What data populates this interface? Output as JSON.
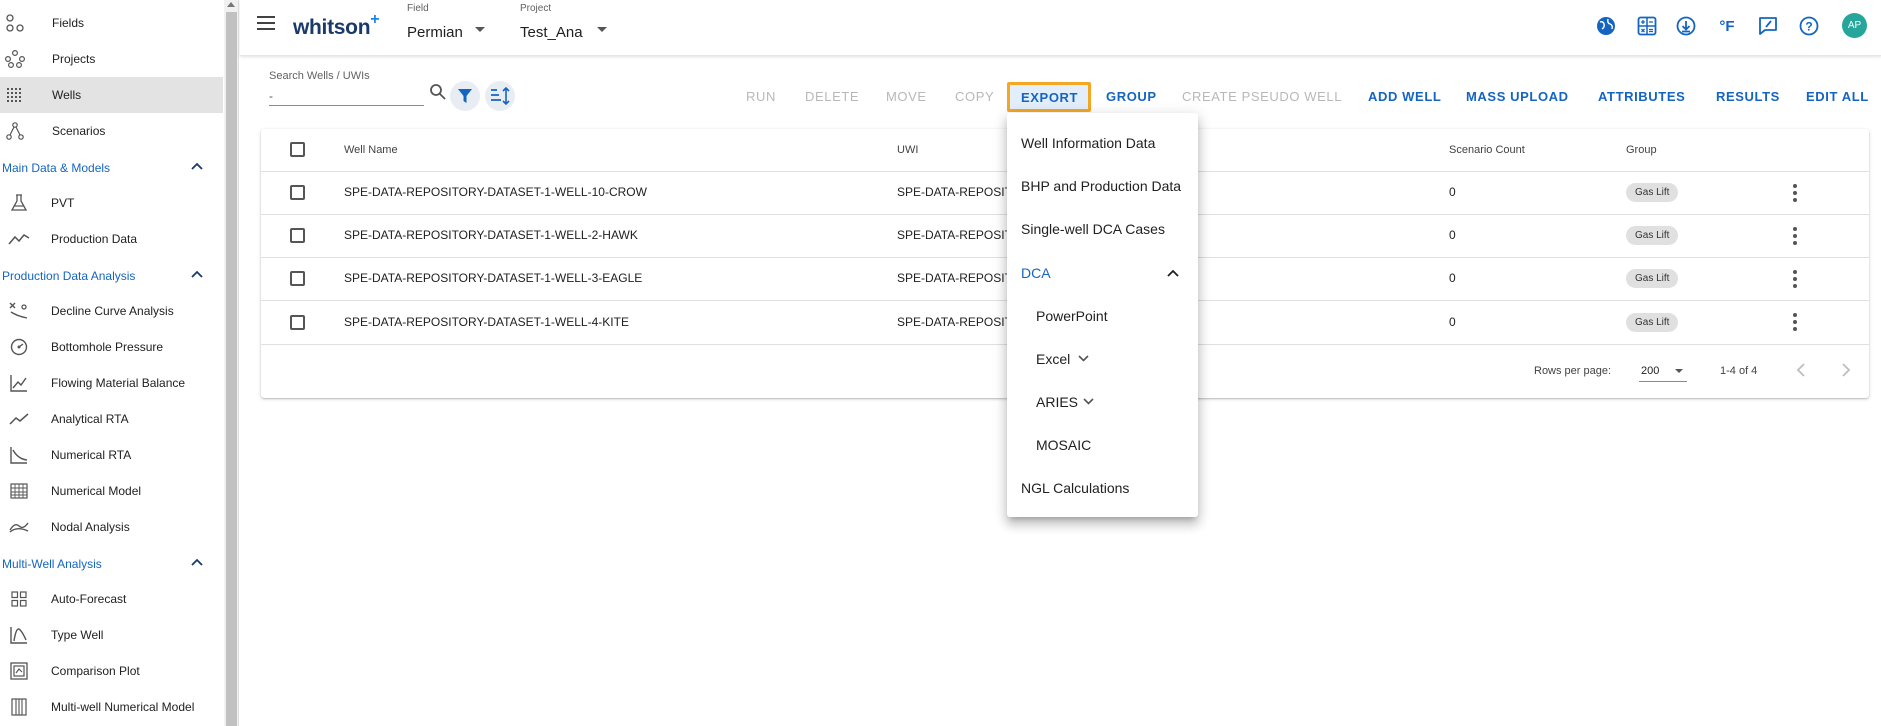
{
  "sidebar": {
    "top_items": [
      {
        "label": "Fields",
        "icon": "fields-icon"
      },
      {
        "label": "Projects",
        "icon": "projects-icon"
      },
      {
        "label": "Wells",
        "icon": "wells-icon",
        "active": true
      },
      {
        "label": "Scenarios",
        "icon": "scenarios-icon"
      }
    ],
    "sections": [
      {
        "title": "Main Data & Models",
        "items": [
          {
            "label": "PVT",
            "icon": "flask-icon"
          },
          {
            "label": "Production Data",
            "icon": "trend-line-icon"
          }
        ]
      },
      {
        "title": "Production Data Analysis",
        "items": [
          {
            "label": "Decline Curve Analysis",
            "icon": "decline-curve-icon"
          },
          {
            "label": "Bottomhole Pressure",
            "icon": "gauge-icon"
          },
          {
            "label": "Flowing Material Balance",
            "icon": "fmb-chart-icon"
          },
          {
            "label": "Analytical RTA",
            "icon": "analytical-rta-icon"
          },
          {
            "label": "Numerical RTA",
            "icon": "numerical-rta-icon"
          },
          {
            "label": "Numerical Model",
            "icon": "grid-model-icon"
          },
          {
            "label": "Nodal Analysis",
            "icon": "nodal-analysis-icon"
          }
        ]
      },
      {
        "title": "Multi-Well Analysis",
        "items": [
          {
            "label": "Auto-Forecast",
            "icon": "auto-forecast-icon"
          },
          {
            "label": "Type Well",
            "icon": "type-well-icon"
          },
          {
            "label": "Comparison Plot",
            "icon": "comparison-plot-icon"
          },
          {
            "label": "Multi-well Numerical Model",
            "icon": "multiwell-model-icon"
          }
        ]
      }
    ]
  },
  "header": {
    "logo": "whitson",
    "logo_plus": "+",
    "field_label": "Field",
    "field_value": "Permian",
    "project_label": "Project",
    "project_value": "Test_Ana",
    "icons": [
      "globe-icon",
      "calculator-icon",
      "download-icon",
      "fahrenheit-icon",
      "feedback-icon",
      "help-icon"
    ],
    "unit_text": "°F",
    "help_text": "?",
    "avatar": "AP"
  },
  "search": {
    "label": "Search Wells / UWIs",
    "value": "-"
  },
  "toolbar": {
    "run": "RUN",
    "delete": "DELETE",
    "move": "MOVE",
    "copy": "COPY",
    "export": "EXPORT",
    "group": "GROUP",
    "create_pseudo": "CREATE PSEUDO WELL",
    "add_well": "ADD WELL",
    "mass_upload": "MASS UPLOAD",
    "attributes": "ATTRIBUTES",
    "results": "RESULTS",
    "edit_all": "EDIT ALL"
  },
  "table": {
    "columns": {
      "well_name": "Well Name",
      "uwi": "UWI",
      "scenario_count": "Scenario Count",
      "group": "Group"
    },
    "rows": [
      {
        "well_name": "SPE-DATA-REPOSITORY-DATASET-1-WELL-10-CROW",
        "uwi": "SPE-DATA-REPOSIT",
        "scenario_count": "0",
        "group": "Gas Lift"
      },
      {
        "well_name": "SPE-DATA-REPOSITORY-DATASET-1-WELL-2-HAWK",
        "uwi": "SPE-DATA-REPOSIT",
        "scenario_count": "0",
        "group": "Gas Lift"
      },
      {
        "well_name": "SPE-DATA-REPOSITORY-DATASET-1-WELL-3-EAGLE",
        "uwi": "SPE-DATA-REPOSIT",
        "scenario_count": "0",
        "group": "Gas Lift"
      },
      {
        "well_name": "SPE-DATA-REPOSITORY-DATASET-1-WELL-4-KITE",
        "uwi": "SPE-DATA-REPOSIT",
        "scenario_count": "0",
        "group": "Gas Lift"
      }
    ],
    "rows_per_page_label": "Rows per page:",
    "rows_per_page_value": "200",
    "range_text": "1-4 of 4"
  },
  "export_menu": {
    "items": [
      {
        "label": "Well Information Data"
      },
      {
        "label": "BHP and Production Data"
      },
      {
        "label": "Single-well DCA Cases"
      },
      {
        "label": "DCA",
        "expanded": true
      },
      {
        "label": "PowerPoint"
      },
      {
        "label": "Excel"
      },
      {
        "label": "ARIES"
      },
      {
        "label": "MOSAIC"
      },
      {
        "label": "NGL Calculations"
      }
    ]
  },
  "colors": {
    "accent": "#1565c0",
    "highlight_border": "#f5a623",
    "avatar_bg": "#26a69a"
  }
}
